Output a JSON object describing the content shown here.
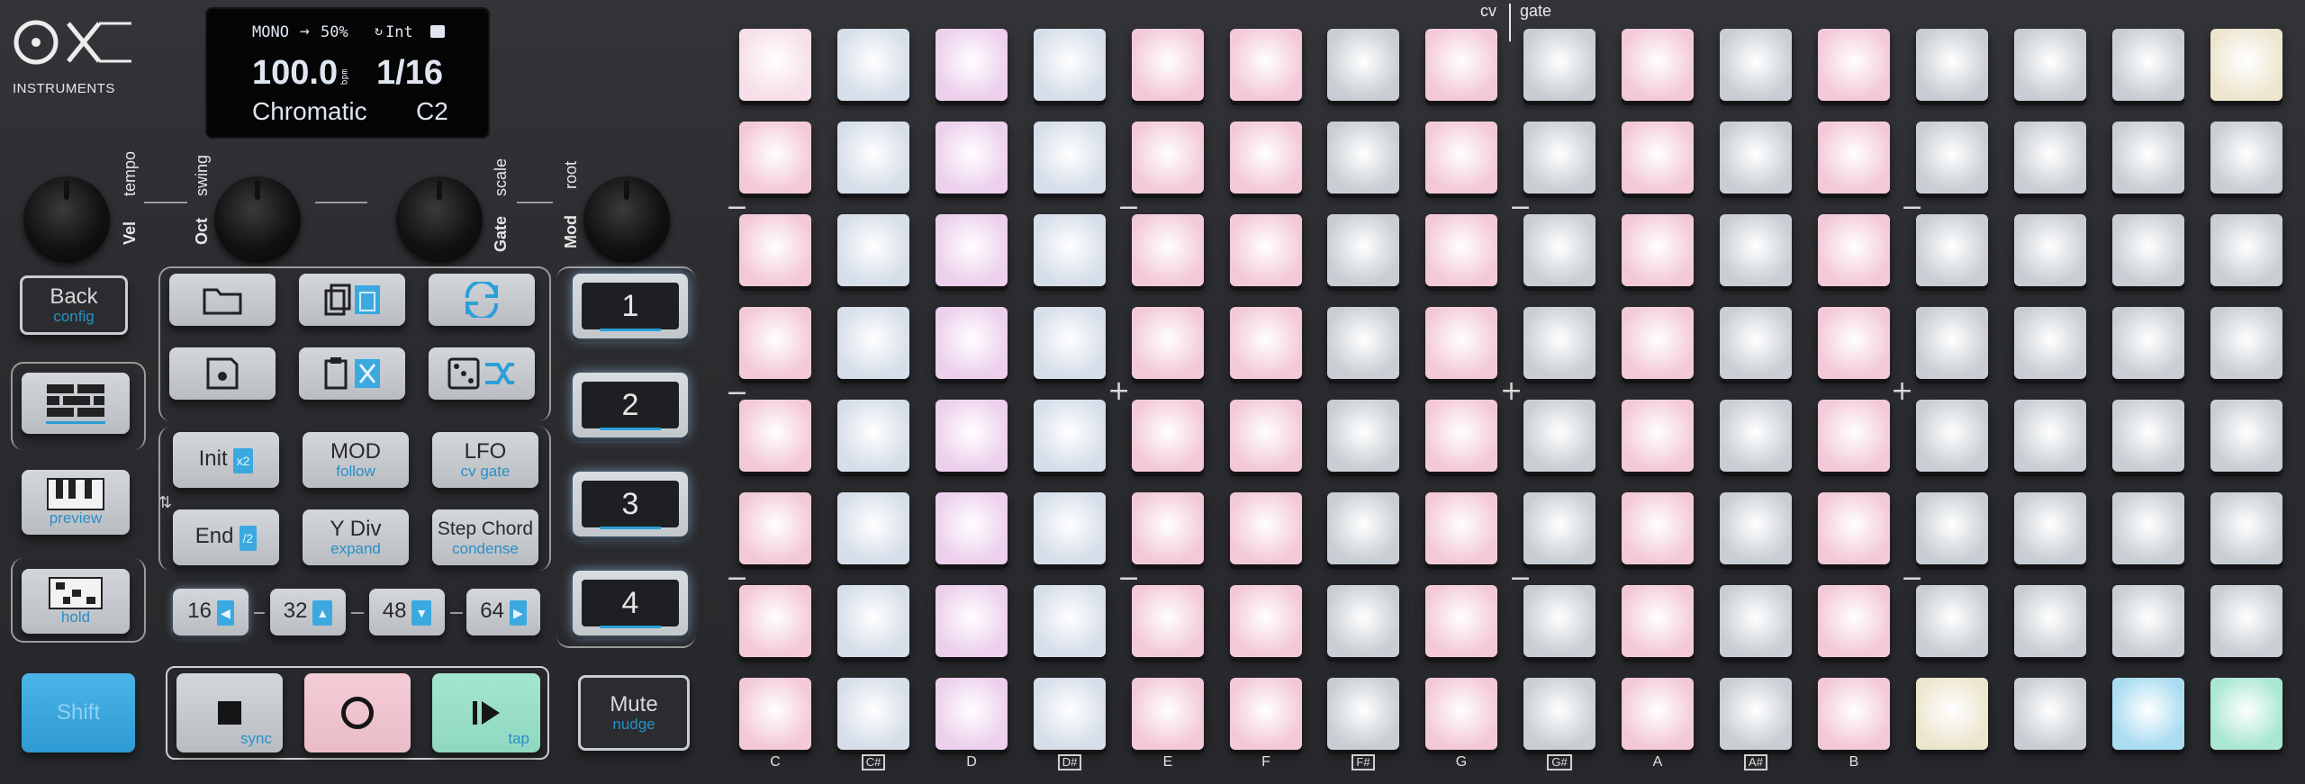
{
  "brand": {
    "logo_mark": "OX",
    "logo_text": "INSTRUMENTS"
  },
  "display": {
    "mode": "MONO",
    "swing": "50%",
    "clock": "Int",
    "tempo": "100.0",
    "bpm_unit": "bpm",
    "division": "1/16",
    "scale": "Chromatic",
    "root": "C2"
  },
  "knobs": [
    {
      "main": "Vel",
      "alt": "tempo"
    },
    {
      "main": "Oct",
      "alt": "swing"
    },
    {
      "main": "Gate",
      "alt": "scale"
    },
    {
      "main": "Mod",
      "alt": "root"
    }
  ],
  "left_buttons": {
    "back": {
      "main": "Back",
      "sub": "config"
    },
    "preview": {
      "sub": "preview"
    },
    "hold": {
      "sub": "hold"
    },
    "shift": {
      "main": "Shift"
    }
  },
  "func_buttons": {
    "init": {
      "main": "Init",
      "tag": "x2"
    },
    "end": {
      "main": "End",
      "tag": "/2"
    },
    "mod": {
      "main": "MOD",
      "sub": "follow"
    },
    "ydiv": {
      "main": "Y Div",
      "sub": "expand"
    },
    "lfo": {
      "main": "LFO",
      "sub": "cv gate"
    },
    "stepchord": {
      "main": "Step Chord",
      "sub": "condense"
    }
  },
  "length_buttons": [
    {
      "main": "16",
      "arrow": "◀"
    },
    {
      "main": "32",
      "arrow": "▲"
    },
    {
      "main": "48",
      "arrow": "▼"
    },
    {
      "main": "64",
      "arrow": "▶"
    }
  ],
  "transport": {
    "stop_sub": "sync",
    "play_sub": "tap"
  },
  "tracks": [
    "1",
    "2",
    "3",
    "4"
  ],
  "mute": {
    "main": "Mute",
    "sub": "nudge"
  },
  "grid_header": {
    "cv": "cv",
    "gate": "gate"
  },
  "notes": [
    "C",
    "C#",
    "D",
    "D#",
    "E",
    "F",
    "F#",
    "G",
    "G#",
    "A",
    "A#",
    "B"
  ],
  "grid_marks": {
    "minus": "−",
    "plus": "+"
  },
  "colors": {
    "pink": "#f3c9d8",
    "lavender": "#ecd0ec",
    "ice": "#d6dee9",
    "grey": "#c8ced3",
    "cream": "#ede6cf",
    "sky": "#a9dcf1",
    "mint": "#a9e7d3",
    "accent_blue": "#3ba9e0"
  }
}
